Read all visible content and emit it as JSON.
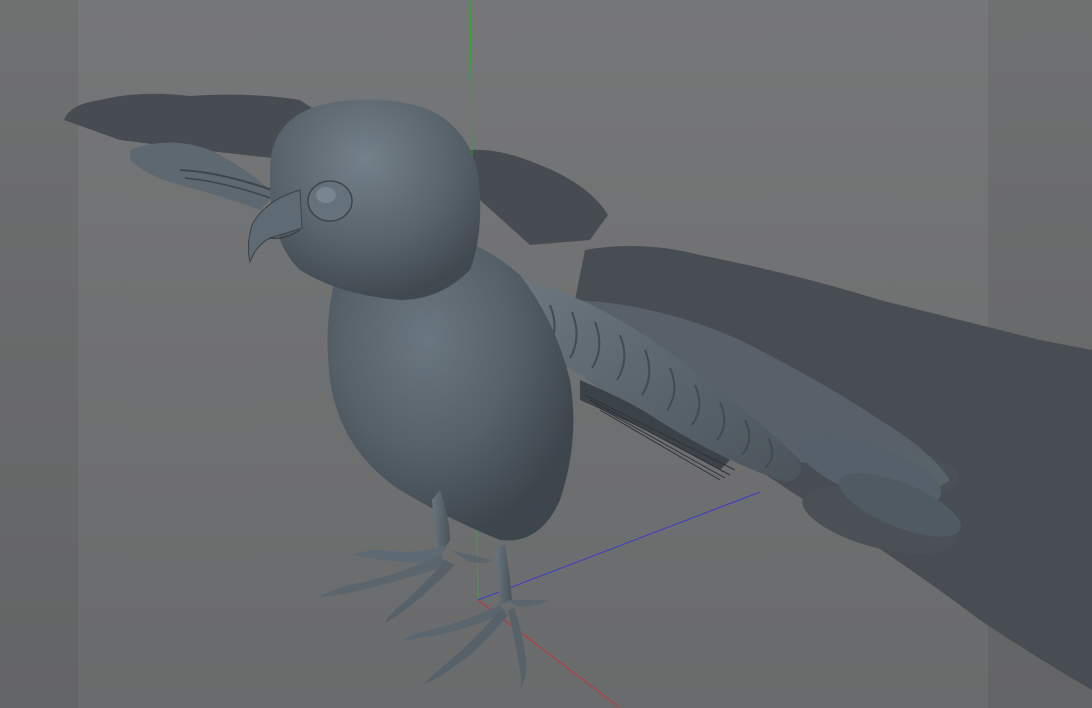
{
  "viewport": {
    "label": "",
    "colors": {
      "background": "#707172",
      "model": "#556068",
      "model_dark": "#3f474e",
      "shadow": "#454b50",
      "axis_x": "#c0363a",
      "axis_y": "#2fa832",
      "axis_z": "#3a3ad0"
    },
    "model_name": "bird"
  }
}
